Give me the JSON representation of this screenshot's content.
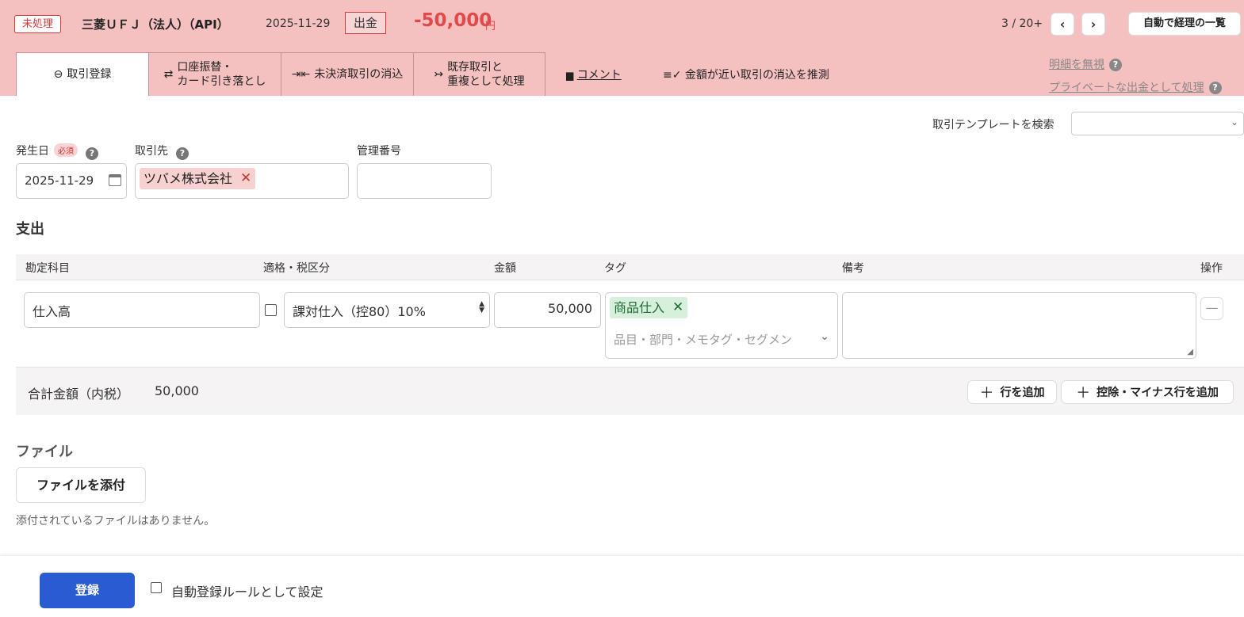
{
  "header": {
    "status": "未処理",
    "bank": "三菱ＵＦＪ（法人）（API）",
    "date": "2025-11-29",
    "type": "出金",
    "amount": "-50,000",
    "amount_unit": "円",
    "pager": "3 / 20+",
    "prev_icon": "chevron-left-icon",
    "next_icon": "chevron-right-icon",
    "list_button": "自動で経理の一覧"
  },
  "tabs": [
    {
      "label": "取引登録",
      "icon": "minus-circle-icon"
    },
    {
      "label": "口座振替・\nカード引き落とし",
      "icon": "swap-icon"
    },
    {
      "label": "未決済取引の消込",
      "icon": "merge-icon"
    },
    {
      "label": "既存取引と\n重複として処理",
      "icon": "duplicate-arrow-icon"
    }
  ],
  "links": {
    "comment": "コメント",
    "guess": "金額が近い取引の消込を推測",
    "ignore": "明細を無視",
    "private": "プライベートな出金として処理"
  },
  "form": {
    "template_label": "取引テンプレートを検索",
    "date_label": "発生日",
    "required": "必須",
    "date_value": "2025-11-29",
    "partner_label": "取引先",
    "partner_value": "ツバメ株式会社",
    "mgmt_label": "管理番号"
  },
  "section": {
    "title": "支出"
  },
  "table": {
    "headers": [
      "勘定科目",
      "適格・税区分",
      "金額",
      "タグ",
      "備考",
      "操作"
    ],
    "row": {
      "account": "仕入高",
      "tax": "課対仕入（控80）10%",
      "amount": "50,000",
      "tag": "商品仕入",
      "tag_placeholder": "品目・部門・メモタグ・セグメン"
    }
  },
  "total": {
    "label": "合計金額（内税）",
    "value": "50,000",
    "add_row": "行を追加",
    "add_minus_row": "控除・マイナス行を追加"
  },
  "file": {
    "title": "ファイル",
    "attach_button": "ファイルを添付",
    "empty_message": "添付されているファイルはありません。"
  },
  "footer": {
    "submit": "登録",
    "rule_label": "自動登録ルールとして設定"
  },
  "colors": {
    "header_bg": "#f5c0c0",
    "amount_red": "#e04a4a",
    "primary_blue": "#2a5bd0"
  }
}
